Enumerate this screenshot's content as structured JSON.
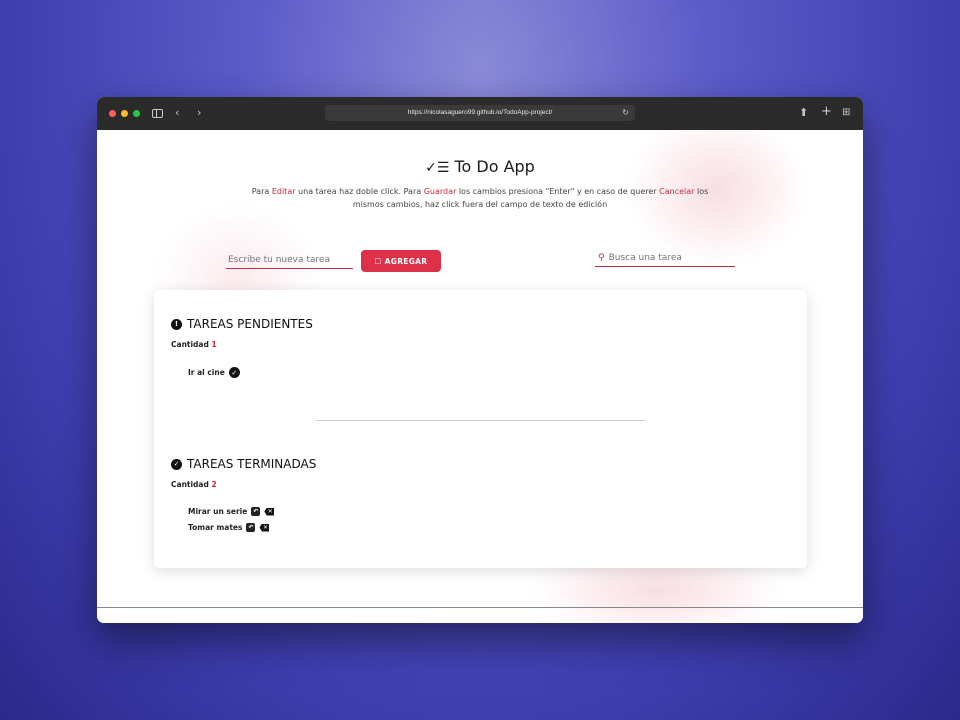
{
  "browser": {
    "url": "https://nicolasaguero99.github.io/TodoApp-project/",
    "icons": {
      "back": "chevron-left-icon",
      "forward": "chevron-right-icon",
      "reload": "reload-icon",
      "share": "share-icon",
      "new_tab": "plus-icon",
      "tabs": "tab-grid-icon"
    }
  },
  "header": {
    "title": "To Do App",
    "instructions": {
      "p1": "Para ",
      "editar": "Editar",
      "p2": " una tarea haz doble click. Para ",
      "guardar": "Guardar",
      "p3": " los cambios presiona \"Enter\" y en caso de querer ",
      "cancelar": "Cancelar",
      "p4": " los mismos cambios, haz click fuera del campo de texto de edición"
    }
  },
  "new_task": {
    "placeholder": "Escribe tu nueva tarea",
    "add_label": "AGREGAR"
  },
  "search": {
    "placeholder": "Busca una tarea"
  },
  "pending": {
    "title": "TAREAS PENDIENTES",
    "count_label": "Cantidad",
    "count": "1",
    "tasks": [
      "Ir al cine"
    ]
  },
  "done": {
    "title": "TAREAS TERMINADAS",
    "count_label": "Cantidad",
    "count": "2",
    "tasks": [
      "Mirar un serie",
      "Tomar mates"
    ]
  },
  "colors": {
    "accent": "#dc3149",
    "accent_text": "#c42b3d",
    "dark": "#111111"
  }
}
